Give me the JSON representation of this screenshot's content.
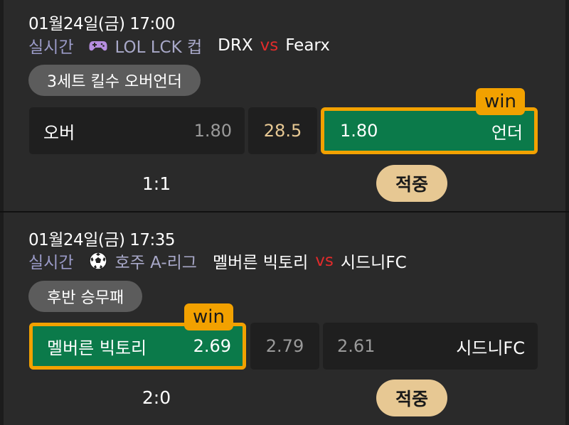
{
  "bets": [
    {
      "datetime": "01월24일(금) 17:00",
      "status": "실시간",
      "sport_icon": "gamepad-icon",
      "league": "LOL LCK 컵",
      "home": "DRX",
      "vs": "vs",
      "away": "Fearx",
      "market": "3세트 킬수 오버언더",
      "left_label": "오버",
      "left_odds": "1.80",
      "middle_value": "28.5",
      "right_odds": "1.80",
      "right_label": "언더",
      "selected": "right",
      "win_tag": "win",
      "score": "1:1",
      "result": "적중"
    },
    {
      "datetime": "01월24일(금) 17:35",
      "status": "실시간",
      "sport_icon": "soccer-ball-icon",
      "league": "호주 A-리그",
      "home": "멜버른 빅토리",
      "vs": "vs",
      "away": "시드니FC",
      "market": "후반 승무패",
      "left_label": "멜버른 빅토리",
      "left_odds": "2.69",
      "middle_value": "2.79",
      "right_odds": "2.61",
      "right_label": "시드니FC",
      "selected": "left",
      "win_tag": "win",
      "score": "2:0",
      "result": "적중"
    }
  ],
  "colors": {
    "background": "#2a2a2a",
    "box": "#1f1f1f",
    "win_green": "#0b7a4a",
    "win_border": "#f2a100",
    "vs_red": "#e22b2b",
    "result_gold": "#e7c893",
    "status_purple": "#9b9bc8"
  }
}
